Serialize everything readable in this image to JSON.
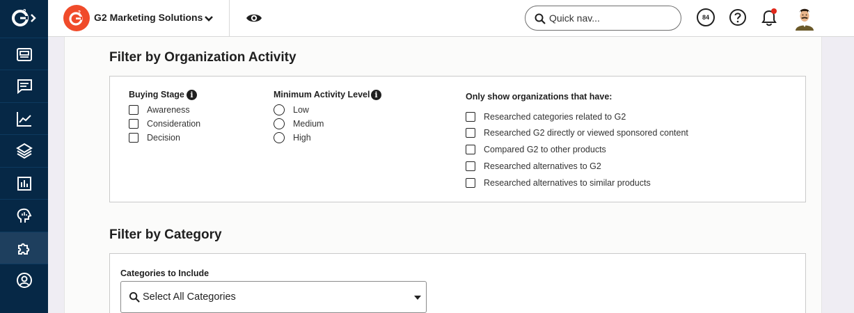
{
  "topbar": {
    "brand_badge": "G2",
    "brand_name": "G2 Marketing Solutions",
    "quicknav_placeholder": "Quick nav...",
    "score": "84",
    "accent": "#f04b2a"
  },
  "rail": {
    "logo": "G2",
    "items": [
      {
        "icon": "dashboard-icon"
      },
      {
        "icon": "reviews-icon"
      },
      {
        "icon": "analytics-icon"
      },
      {
        "icon": "layers-icon"
      },
      {
        "icon": "reports-icon"
      },
      {
        "icon": "buyer-intent-icon"
      },
      {
        "icon": "integrations-icon"
      },
      {
        "icon": "account-icon"
      }
    ]
  },
  "org_activity": {
    "title": "Filter by Organization Activity",
    "buying_stage": {
      "label": "Buying Stage",
      "options": [
        "Awareness",
        "Consideration",
        "Decision"
      ]
    },
    "min_activity": {
      "label": "Minimum Activity Level",
      "options": [
        "Low",
        "Medium",
        "High"
      ]
    },
    "only_show": {
      "label": "Only show organizations that have:",
      "options": [
        "Researched categories related to G2",
        "Researched G2 directly or viewed sponsored content",
        "Compared G2 to other products",
        "Researched alternatives to G2",
        "Researched alternatives to similar products"
      ]
    }
  },
  "category": {
    "title": "Filter by Category",
    "include_label": "Categories to Include",
    "select_value": "Select All Categories"
  }
}
